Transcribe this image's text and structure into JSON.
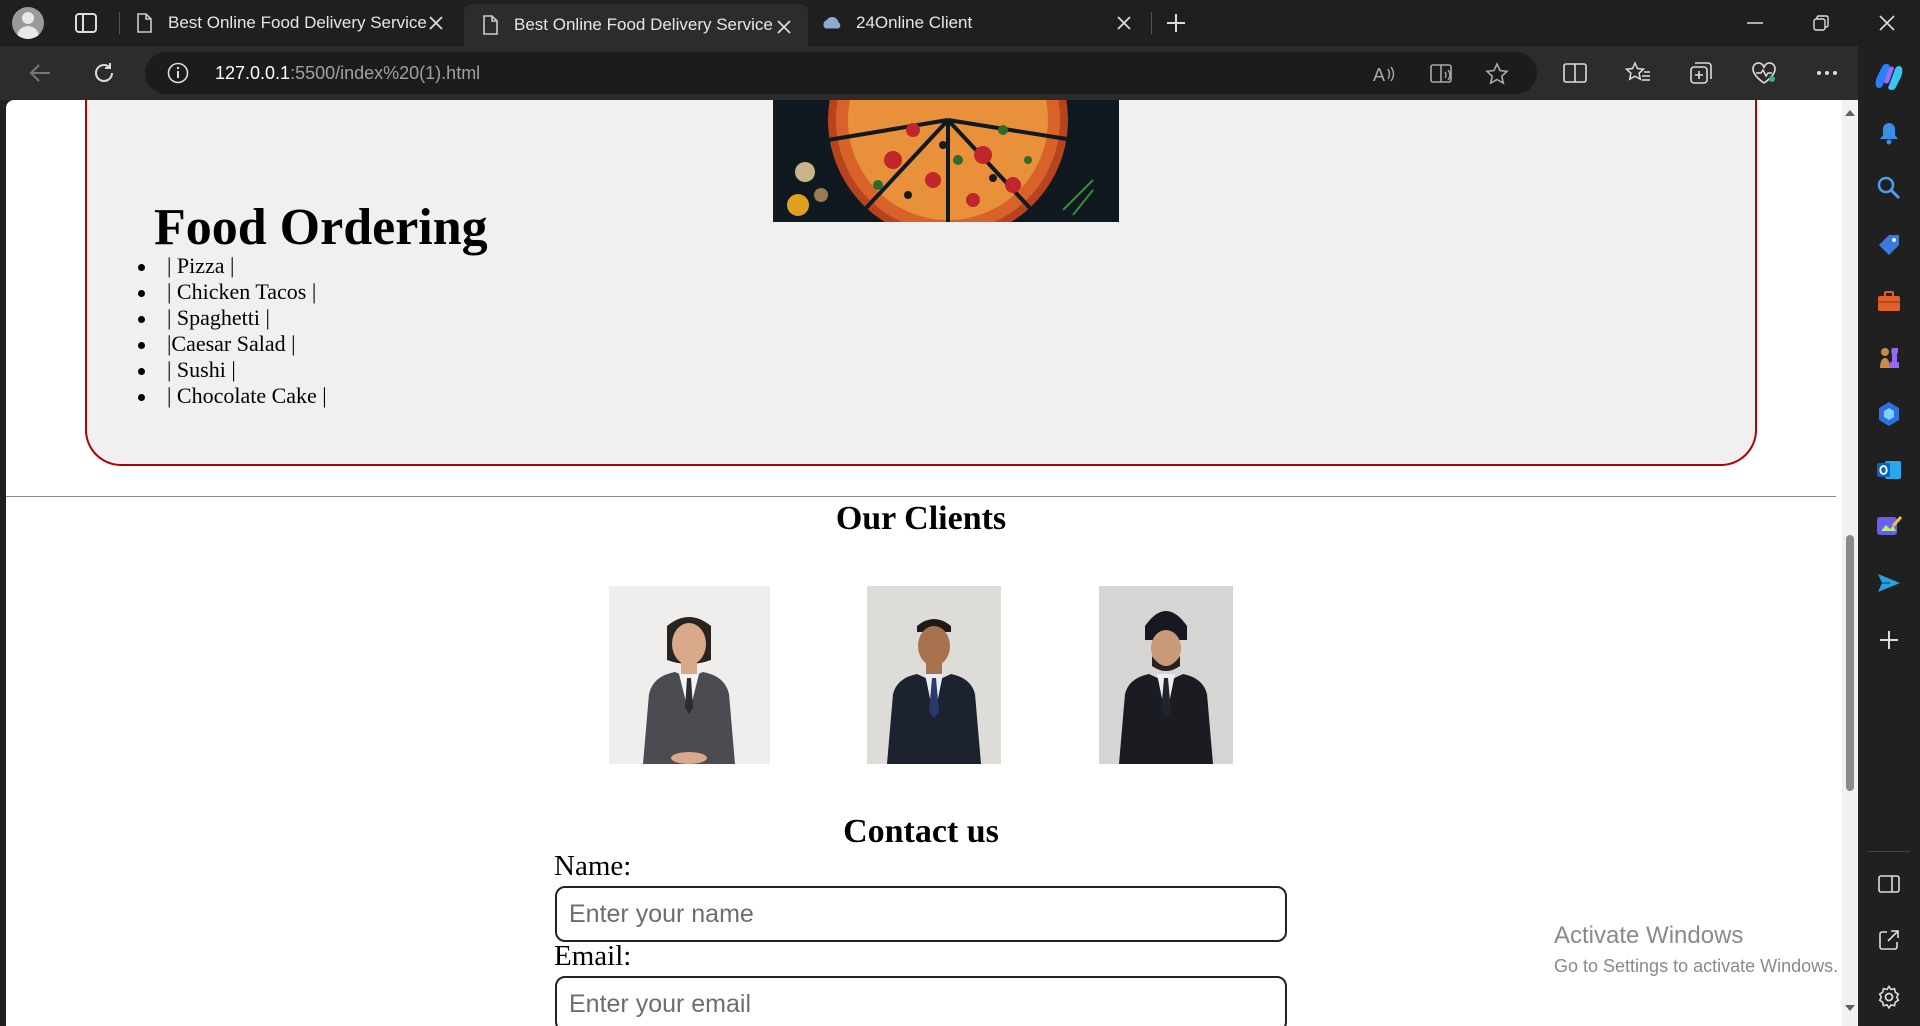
{
  "browser": {
    "tabs": [
      {
        "title": "Best Online Food Delivery Service",
        "active": false,
        "favicon": "page-icon"
      },
      {
        "title": "Best Online Food Delivery Service",
        "active": true,
        "favicon": "page-icon"
      },
      {
        "title": "24Online Client",
        "active": false,
        "favicon": "cloud-icon"
      }
    ],
    "address": {
      "host": "127.0.0.1",
      "rest": ":5500/index%20(1).html"
    }
  },
  "page": {
    "food_title": "Food Ordering",
    "food_items": [
      "| Pizza |",
      "| Chicken Tacos |",
      "| Spaghetti |",
      "|Caesar Salad |",
      "| Sushi |",
      "| Chocolate Cake |"
    ],
    "clients_title": "Our Clients",
    "contact_title": "Contact us",
    "name_label": "Name:",
    "name_placeholder": "Enter your name",
    "email_label": "Email:",
    "email_placeholder": "Enter your email"
  },
  "windows_watermark": {
    "line1": "Activate Windows",
    "line2": "Go to Settings to activate Windows."
  },
  "colors": {
    "section_border": "#b00000",
    "section_bg": "#f0f0f0",
    "chrome_bg": "#2c2c2c"
  }
}
